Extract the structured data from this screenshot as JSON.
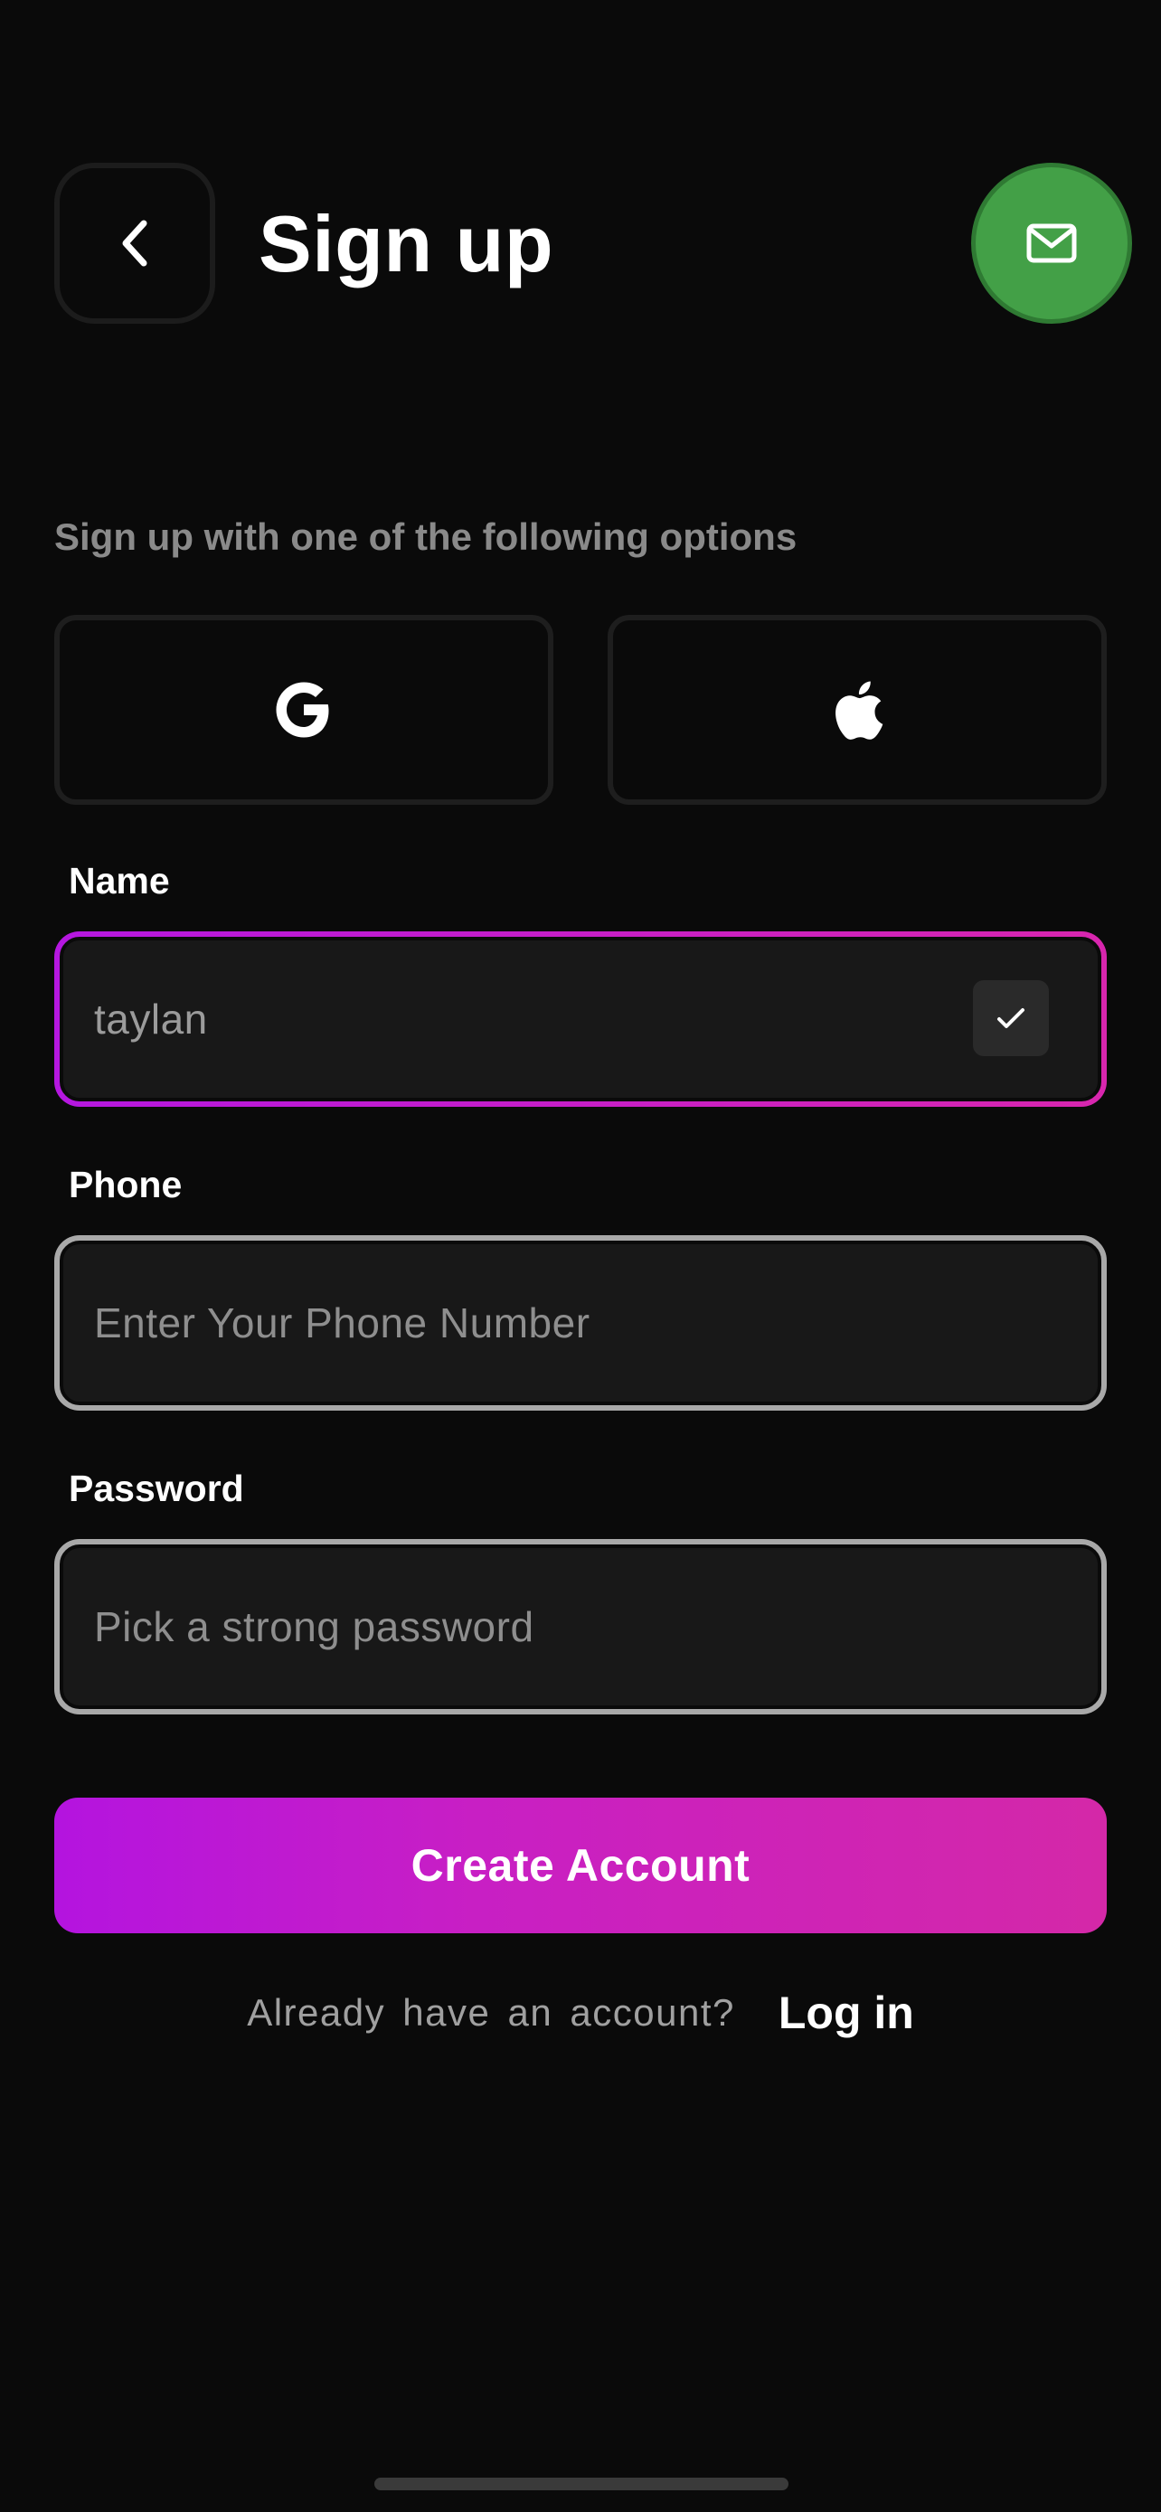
{
  "header": {
    "title": "Sign up",
    "back_icon": "chevron-left-icon",
    "mail_icon": "mail-icon",
    "mail_button_color": "#43a047"
  },
  "social": {
    "prompt": "Sign up with one of the following options",
    "google_icon": "google-icon",
    "apple_icon": "apple-icon"
  },
  "form": {
    "name": {
      "label": "Name",
      "value": "taylan",
      "placeholder": "",
      "valid_icon": "checkmark-icon"
    },
    "phone": {
      "label": "Phone",
      "value": "",
      "placeholder": "Enter Your Phone Number"
    },
    "password": {
      "label": "Password",
      "value": "",
      "placeholder": "Pick a strong password"
    }
  },
  "actions": {
    "create_label": "Create Account",
    "already_text": "Already have an account?",
    "login_label": "Log in"
  },
  "colors": {
    "background": "#0a0a0a",
    "accent_start": "#b414df",
    "accent_end": "#d428a8",
    "input_bg": "#181818"
  }
}
